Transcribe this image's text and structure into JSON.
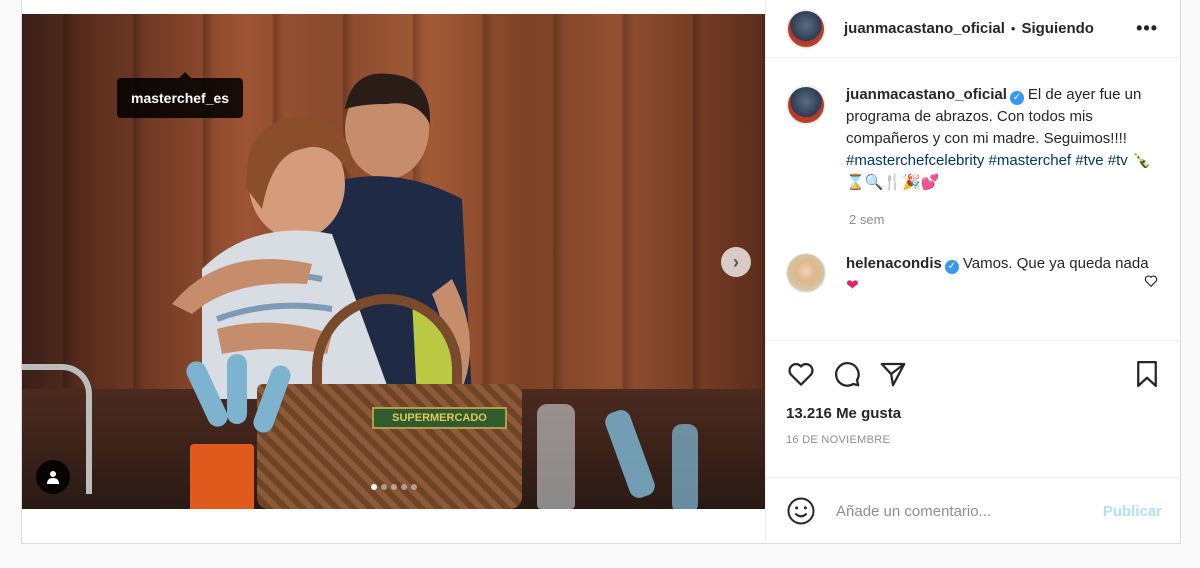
{
  "header": {
    "username": "juanmacastano_oficial",
    "separator": "•",
    "follow_status": "Siguiendo",
    "more_label": "•••"
  },
  "media": {
    "tagged_user": "masterchef_es",
    "next_icon": "chevron-right-icon",
    "user_tag_icon": "user-icon",
    "carousel_count": 5,
    "carousel_active_index": 0,
    "basket_label": "SUPERMERCADO"
  },
  "caption": {
    "username": "juanmacastano_oficial",
    "verified_icon": "check-icon",
    "text": "El de ayer fue un programa de abrazos. Con todos mis compañeros y con mi madre. Seguimos!!!! ",
    "hashtags": "#masterchefcelebrity #masterchef #tve #tv",
    "emojis": "🍾⌛🔍🍴🎉💕",
    "time": "2 sem"
  },
  "comments": [
    {
      "username": "helenacondis",
      "text": "Vamos. Que ya queda nada",
      "emoji": "❤"
    }
  ],
  "actions": {
    "like_icon": "heart-icon",
    "comment_icon": "comment-icon",
    "share_icon": "send-icon",
    "save_icon": "bookmark-icon",
    "likes_count": "13.216",
    "likes_label": "Me gusta",
    "date": "16 DE NOVIEMBRE"
  },
  "add_comment": {
    "emoji_icon": "smile-icon",
    "placeholder": "Añade un comentario...",
    "publish_label": "Publicar"
  },
  "colors": {
    "link": "#00376b",
    "verified": "#3897f0",
    "muted": "#8e8e8e",
    "publish_disabled": "#b2dffc"
  }
}
